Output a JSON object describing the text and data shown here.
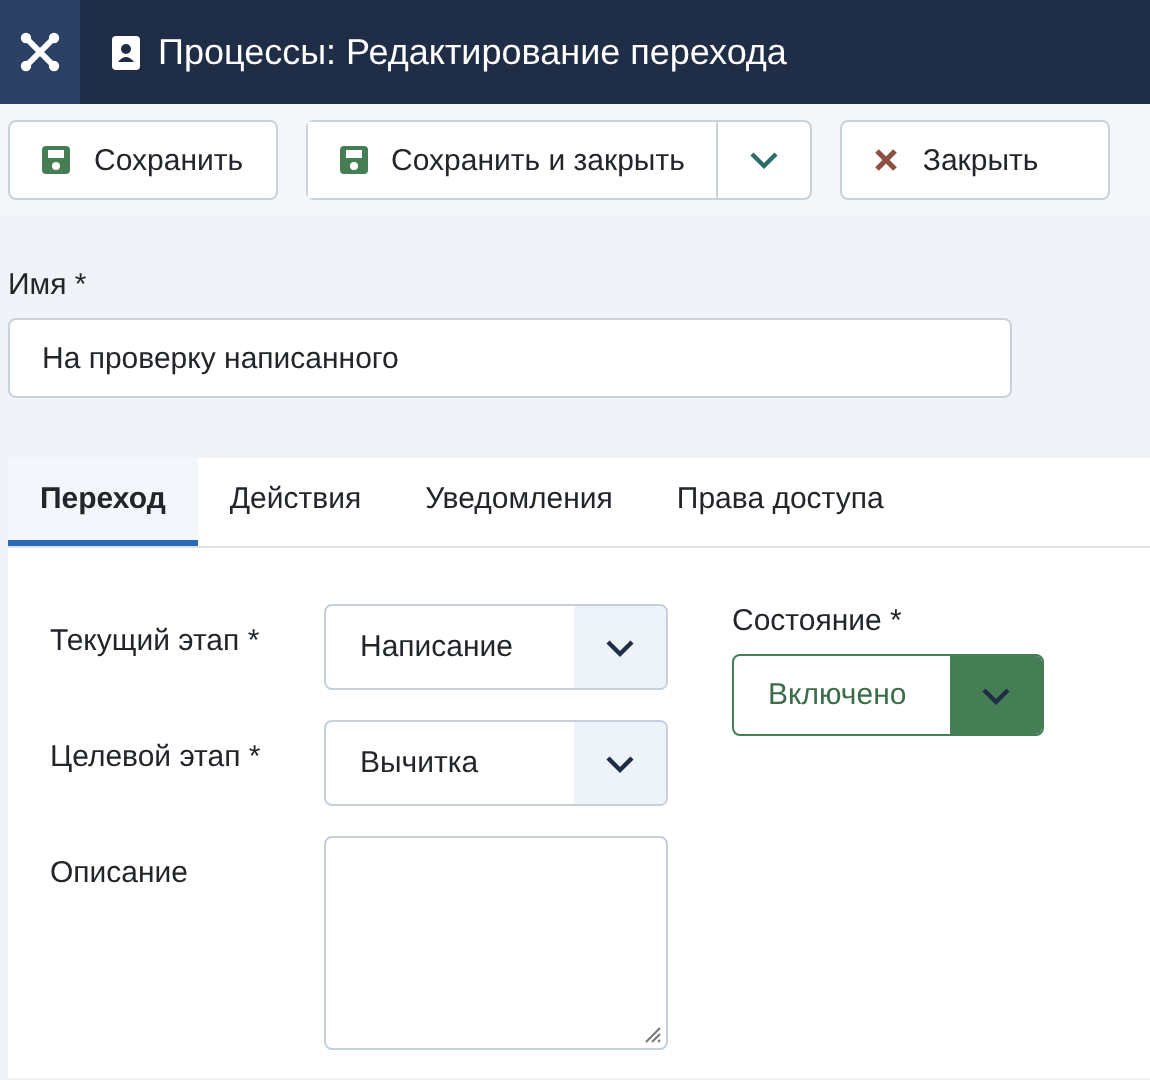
{
  "header": {
    "title": "Процессы: Редактирование перехода"
  },
  "toolbar": [
    {
      "kind": "save",
      "label": "Сохранить"
    },
    {
      "kind": "save-split",
      "label": "Сохранить и закрыть"
    },
    {
      "kind": "close",
      "label": "Закрыть"
    }
  ],
  "name_field": {
    "label": "Имя *",
    "value": "На проверку написанного"
  },
  "tabs": [
    {
      "label": "Переход",
      "selected": true
    },
    {
      "label": "Действия",
      "selected": false
    },
    {
      "label": "Уведомления",
      "selected": false
    },
    {
      "label": "Права доступа",
      "selected": false
    }
  ],
  "fields": [
    {
      "kind": "select",
      "label": "Текущий этап *",
      "value": "Написание"
    },
    {
      "kind": "select",
      "label": "Целевой этап *",
      "value": "Вычитка"
    },
    {
      "kind": "textarea",
      "label": "Описание"
    }
  ],
  "state_field": {
    "label": "Состояние *",
    "value": "Включено"
  }
}
